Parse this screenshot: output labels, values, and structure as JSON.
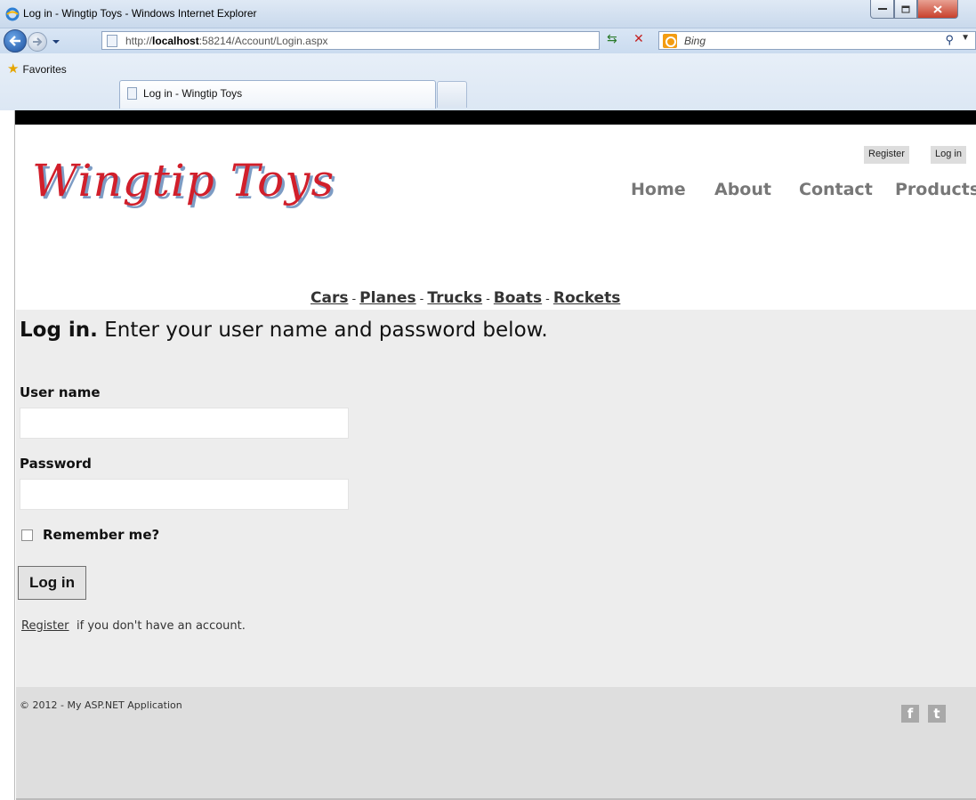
{
  "browser": {
    "window_title": "Log in - Wingtip Toys - Windows Internet Explorer",
    "url_prefix": "http://",
    "url_host": "localhost",
    "url_rest": ":58214/Account/Login.aspx",
    "search_placeholder": "Bing",
    "favorites_label": "Favorites",
    "tab_label": "Log in - Wingtip Toys"
  },
  "site": {
    "logo_text": "Wingtip Toys",
    "top_links": {
      "register": "Register",
      "login": "Log in"
    },
    "nav": {
      "home": "Home",
      "about": "About",
      "contact": "Contact",
      "products": "Products"
    },
    "categories": [
      "Cars",
      "Planes",
      "Trucks",
      "Boats",
      "Rockets"
    ],
    "category_separator": "-"
  },
  "login": {
    "heading_bold": "Log in.",
    "heading_rest": "Enter your user name and password below.",
    "username_label": "User name",
    "username_value": "",
    "password_label": "Password",
    "password_value": "",
    "remember_label": "Remember me?",
    "remember_checked": false,
    "submit_label": "Log in",
    "register_link": "Register",
    "register_suffix": "if you don't have an account."
  },
  "footer": {
    "copyright": "© 2012 - My ASP.NET Application",
    "social": {
      "facebook": "f",
      "twitter": "t"
    }
  },
  "colors": {
    "logo_red": "#d11f2b",
    "logo_shadow": "#7d9cc4",
    "nav_gray": "#777777",
    "main_bg": "#ededed",
    "footer_bg": "#dedede"
  }
}
